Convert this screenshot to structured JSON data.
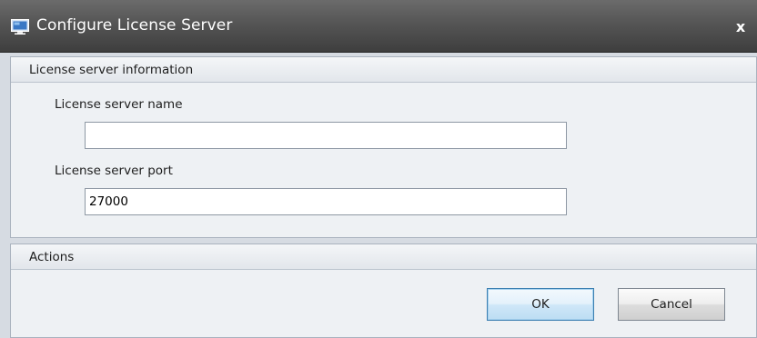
{
  "window": {
    "title": "Configure License Server",
    "close_glyph": "x",
    "icon": "monitor-icon"
  },
  "info_group": {
    "header": "License server information",
    "name_label": "License server name",
    "name_value": "",
    "port_label": "License server port",
    "port_value": "27000"
  },
  "actions_group": {
    "header": "Actions",
    "ok_label": "OK",
    "cancel_label": "Cancel"
  },
  "colors": {
    "titlebar": "#555555",
    "client_background": "#d6dbe2",
    "group_background": "#eef1f4",
    "default_button_border": "#3c7fb1"
  }
}
